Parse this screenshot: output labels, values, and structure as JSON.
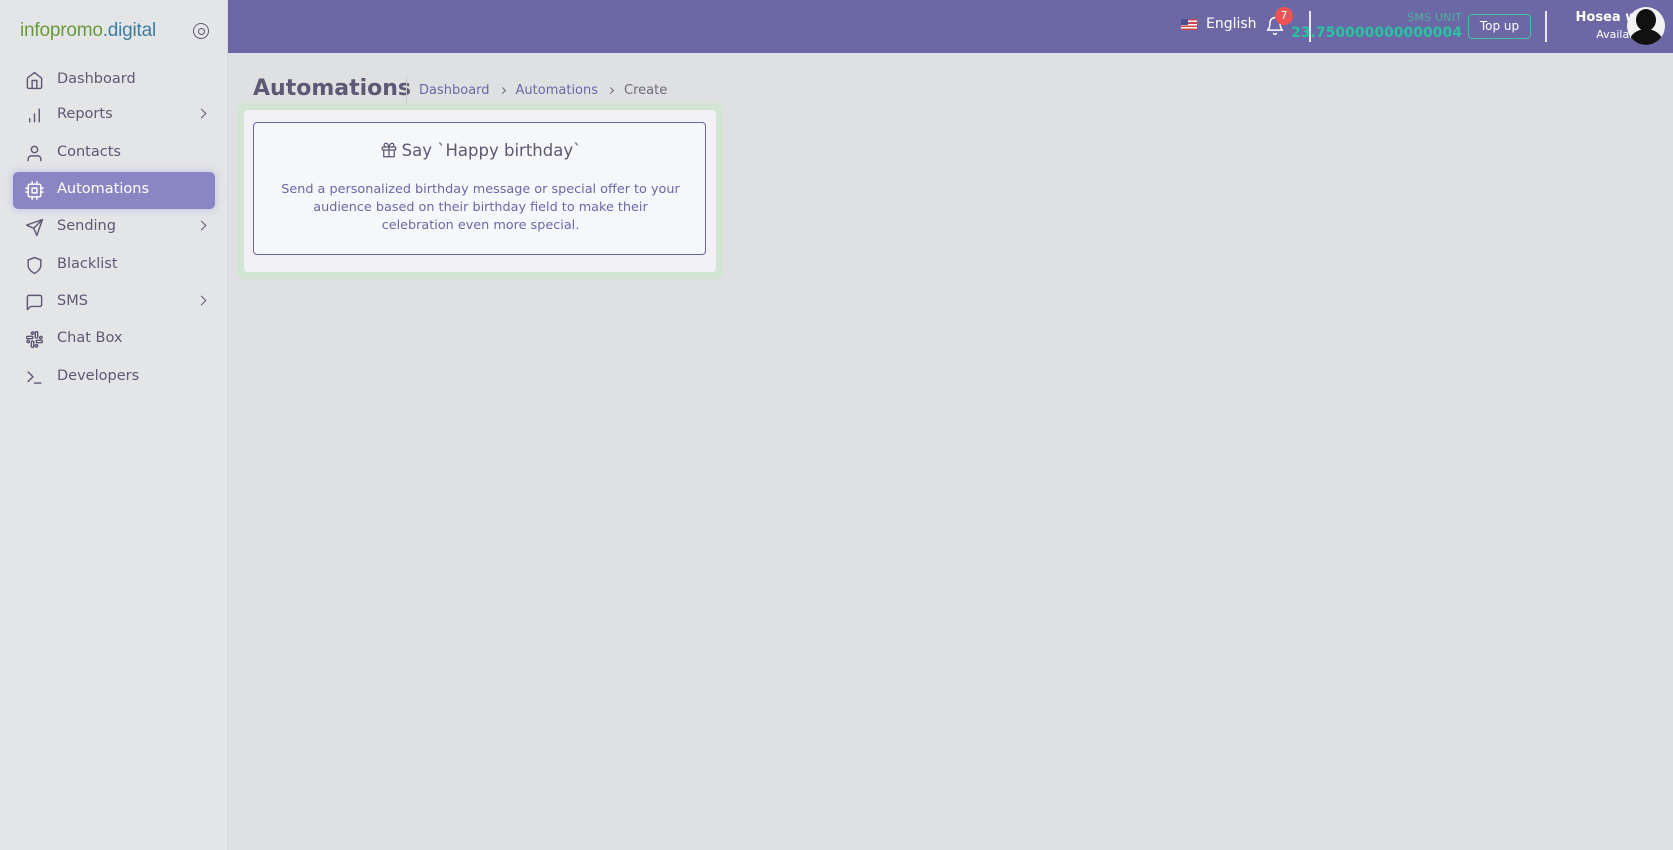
{
  "brand": {
    "logo_part1": "infopromo",
    "logo_part2": ".digital"
  },
  "sidebar": {
    "items": [
      {
        "label": "Dashboard",
        "icon": "home-icon"
      },
      {
        "label": "Reports",
        "icon": "bar-chart-icon"
      },
      {
        "label": "Contacts",
        "icon": "user-icon"
      },
      {
        "label": "Automations",
        "icon": "cpu-icon"
      },
      {
        "label": "Sending",
        "icon": "send-icon"
      },
      {
        "label": "Blacklist",
        "icon": "shield-icon"
      },
      {
        "label": "SMS",
        "icon": "message-square-icon"
      },
      {
        "label": "Chat Box",
        "icon": "slack-icon"
      },
      {
        "label": "Developers",
        "icon": "terminal-icon"
      }
    ],
    "active": "Automations"
  },
  "topbar": {
    "language": "English",
    "notification_count": "7",
    "sms_unit_label": "SMS UNIT",
    "sms_unit_value": "23.750000000000004",
    "topup_label": "Top up",
    "user_name": "Hosea wa",
    "user_status": "Available"
  },
  "page": {
    "title": "Automations",
    "breadcrumb": [
      "Dashboard",
      "Automations",
      "Create"
    ]
  },
  "card": {
    "title": "Say `Happy birthday`",
    "description": "Send a personalized birthday message or special offer to your audience based on their birthday field to make their celebration even more special.",
    "icon": "gift-icon"
  },
  "colors": {
    "topbar": "#6c67a5",
    "active_nav": "#8a86c4",
    "sms_unit": "#28c3a0",
    "badge": "#ea5455"
  }
}
